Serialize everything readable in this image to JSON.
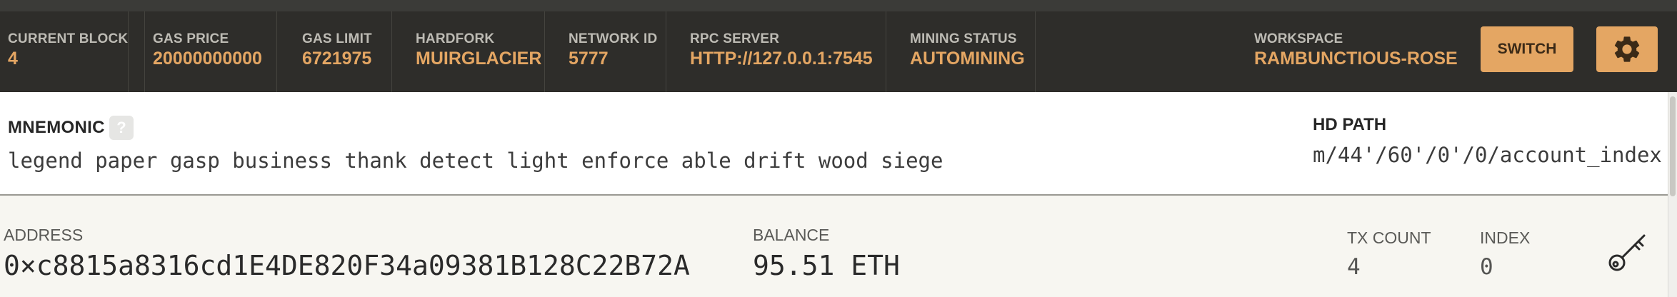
{
  "status_bar": {
    "items": [
      {
        "label": "CURRENT BLOCK",
        "value": "4"
      },
      {
        "label": "GAS PRICE",
        "value": "20000000000"
      },
      {
        "label": "GAS LIMIT",
        "value": "6721975"
      },
      {
        "label": "HARDFORK",
        "value": "MUIRGLACIER"
      },
      {
        "label": "NETWORK ID",
        "value": "5777"
      },
      {
        "label": "RPC SERVER",
        "value": "HTTP://127.0.0.1:7545"
      },
      {
        "label": "MINING STATUS",
        "value": "AUTOMINING"
      }
    ],
    "workspace": {
      "label": "WORKSPACE",
      "value": "RAMBUNCTIOUS-ROSE"
    },
    "switch_label": "SWITCH",
    "settings_icon": "gear-icon"
  },
  "mnemonic": {
    "label": "MNEMONIC",
    "help": "?",
    "value": "legend paper gasp business thank detect light enforce able drift wood siege",
    "hd_path_label": "HD PATH",
    "hd_path_value": "m/44'/60'/0'/0/account_index"
  },
  "accounts": [
    {
      "address_label": "ADDRESS",
      "address": "0×c8815a8316cd1E4DE820F34a09381B128C22B72A",
      "balance_label": "BALANCE",
      "balance": "95.51 ETH",
      "tx_count_label": "TX COUNT",
      "tx_count": "4",
      "index_label": "INDEX",
      "index": "0",
      "key_icon": "key-icon"
    }
  ],
  "colors": {
    "header_bg": "#2e2d2a",
    "accent": "#e4a663",
    "label": "#bdbbb4"
  }
}
